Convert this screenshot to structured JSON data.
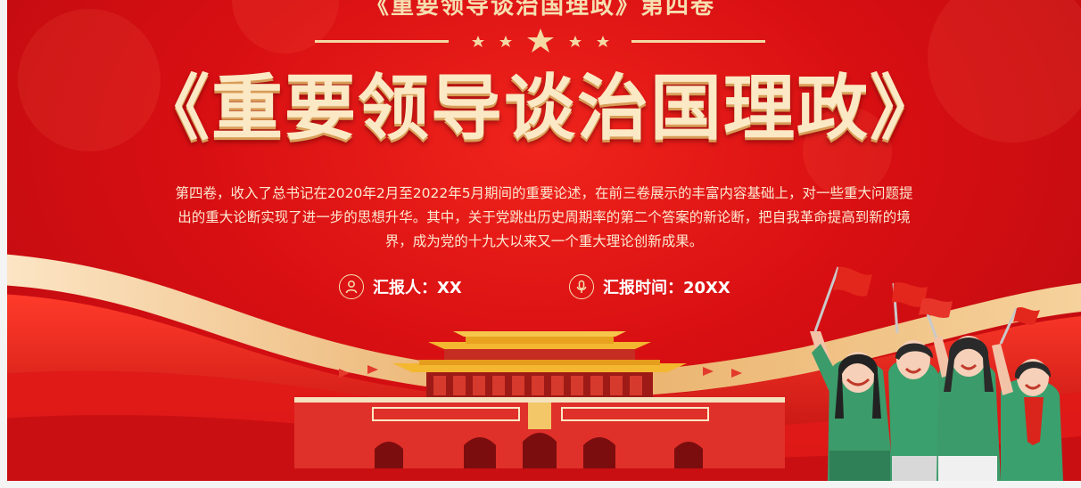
{
  "subtitle": "《重要领导谈治国理政》第四卷",
  "title": "《重要领导谈治国理政》",
  "description": "第四卷，收入了总书记在2020年2月至2022年5月期间的重要论述，在前三卷展示的丰富内容基础上，对一些重大问题提出的重大论断实现了进一步的思想升华。其中，关于党跳出历史周期率的第二个答案的新论断，把自我革命提高到新的境界，成为党的十九大以来又一个重大理论创新成果。",
  "reporter": {
    "label": "汇报人：XX",
    "icon": "person-icon"
  },
  "report_time": {
    "label": "汇报时间：20XX",
    "icon": "microphone-icon"
  },
  "colors": {
    "background": "#d80f12",
    "accent_gold": "#f6dfb0",
    "title": "#fbe8c4"
  }
}
